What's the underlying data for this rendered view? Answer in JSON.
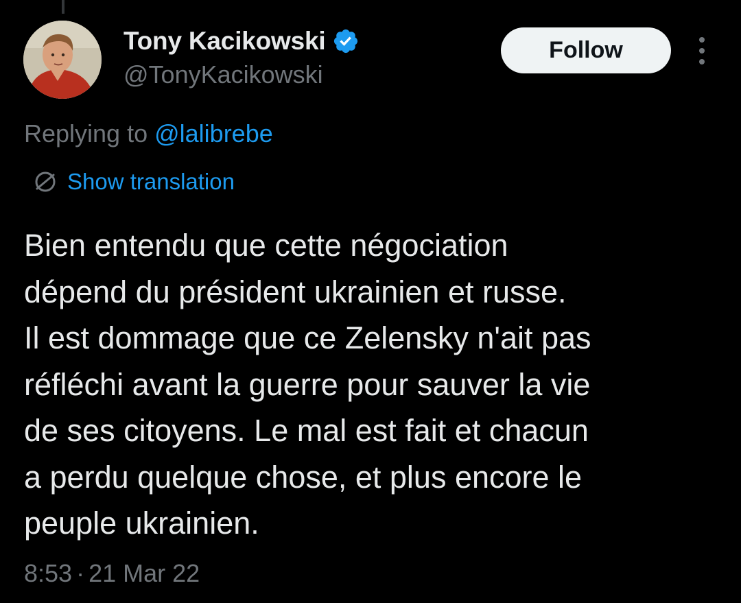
{
  "author": {
    "display_name": "Tony Kacikowski",
    "handle": "@TonyKacikowski",
    "verified_icon": "verified-badge-icon",
    "avatar": "profile-photo"
  },
  "actions": {
    "follow_label": "Follow",
    "more_icon": "more-options-icon"
  },
  "reply": {
    "prefix": "Replying to ",
    "target": "@lalibrebe"
  },
  "translation": {
    "icon": "globe-icon",
    "label": "Show translation"
  },
  "tweet": {
    "lines": [
      "Bien entendu que cette négociation",
      "dépend du président ukrainien et russe.",
      "Il est dommage que ce Zelensky n'ait pas",
      "réfléchi avant la guerre pour sauver la vie",
      "de ses citoyens. Le mal est fait et chacun",
      "a perdu quelque chose, et plus encore le",
      "peuple ukrainien."
    ]
  },
  "meta": {
    "time": "8:53",
    "separator": "·",
    "date": "21 Mar 22"
  },
  "colors": {
    "background": "#000000",
    "text_primary": "#e7e9ea",
    "text_secondary": "#71767b",
    "accent": "#1d9bf0",
    "follow_bg": "#eff3f4"
  }
}
